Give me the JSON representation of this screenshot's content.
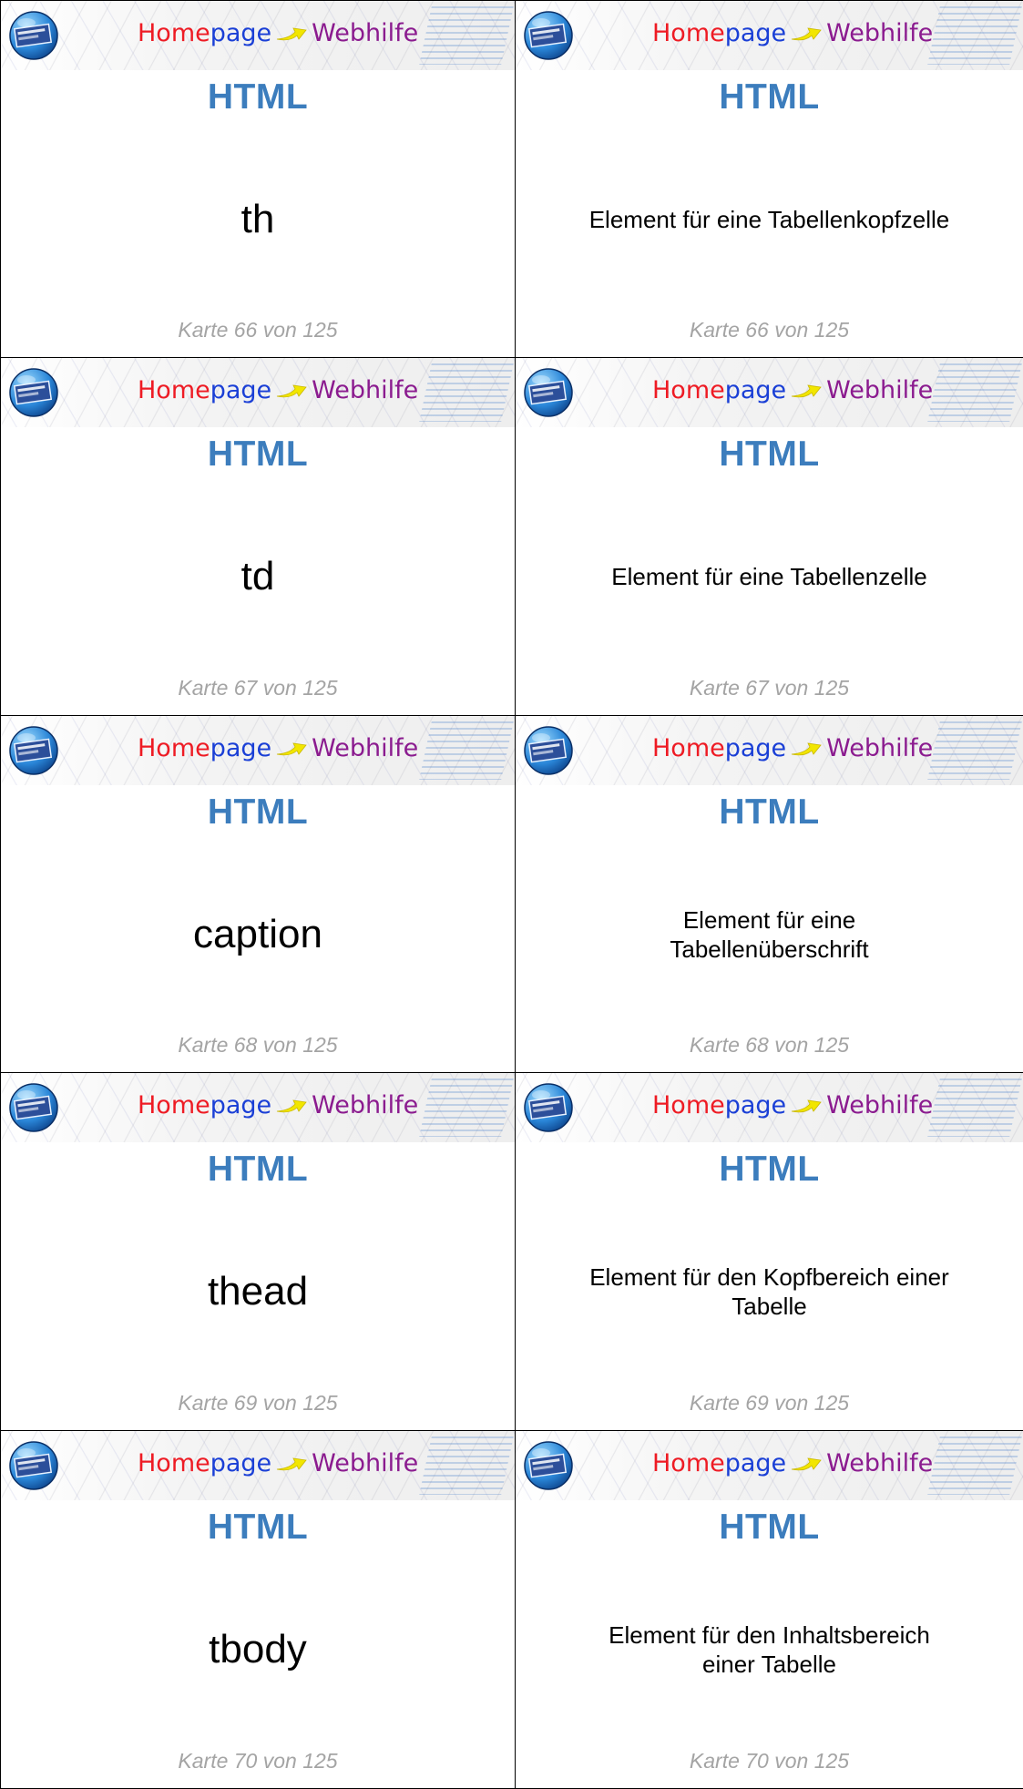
{
  "banner": {
    "logo_home": "Home",
    "logo_page": "page",
    "logo_web": "Webhilfe",
    "brand_colors": {
      "home": "#ee1b24",
      "page": "#1a3fd6",
      "web": "#8b1b8f"
    }
  },
  "subject_color": "#3c7dbd",
  "cards": [
    {
      "subject": "HTML",
      "front": "th",
      "back": "Element für eine Tabellenkopfzelle",
      "footer": "Karte 66 von 125"
    },
    {
      "subject": "HTML",
      "front": "td",
      "back": "Element für eine Tabellenzelle",
      "footer": "Karte 67 von 125"
    },
    {
      "subject": "HTML",
      "front": "caption",
      "back": "Element für eine\nTabellenüberschrift",
      "footer": "Karte 68 von 125"
    },
    {
      "subject": "HTML",
      "front": "thead",
      "back": "Element für den Kopfbereich einer\nTabelle",
      "footer": "Karte 69 von 125"
    },
    {
      "subject": "HTML",
      "front": "tbody",
      "back": "Element für den Inhaltsbereich\neiner Tabelle",
      "footer": "Karte 70 von 125"
    }
  ]
}
